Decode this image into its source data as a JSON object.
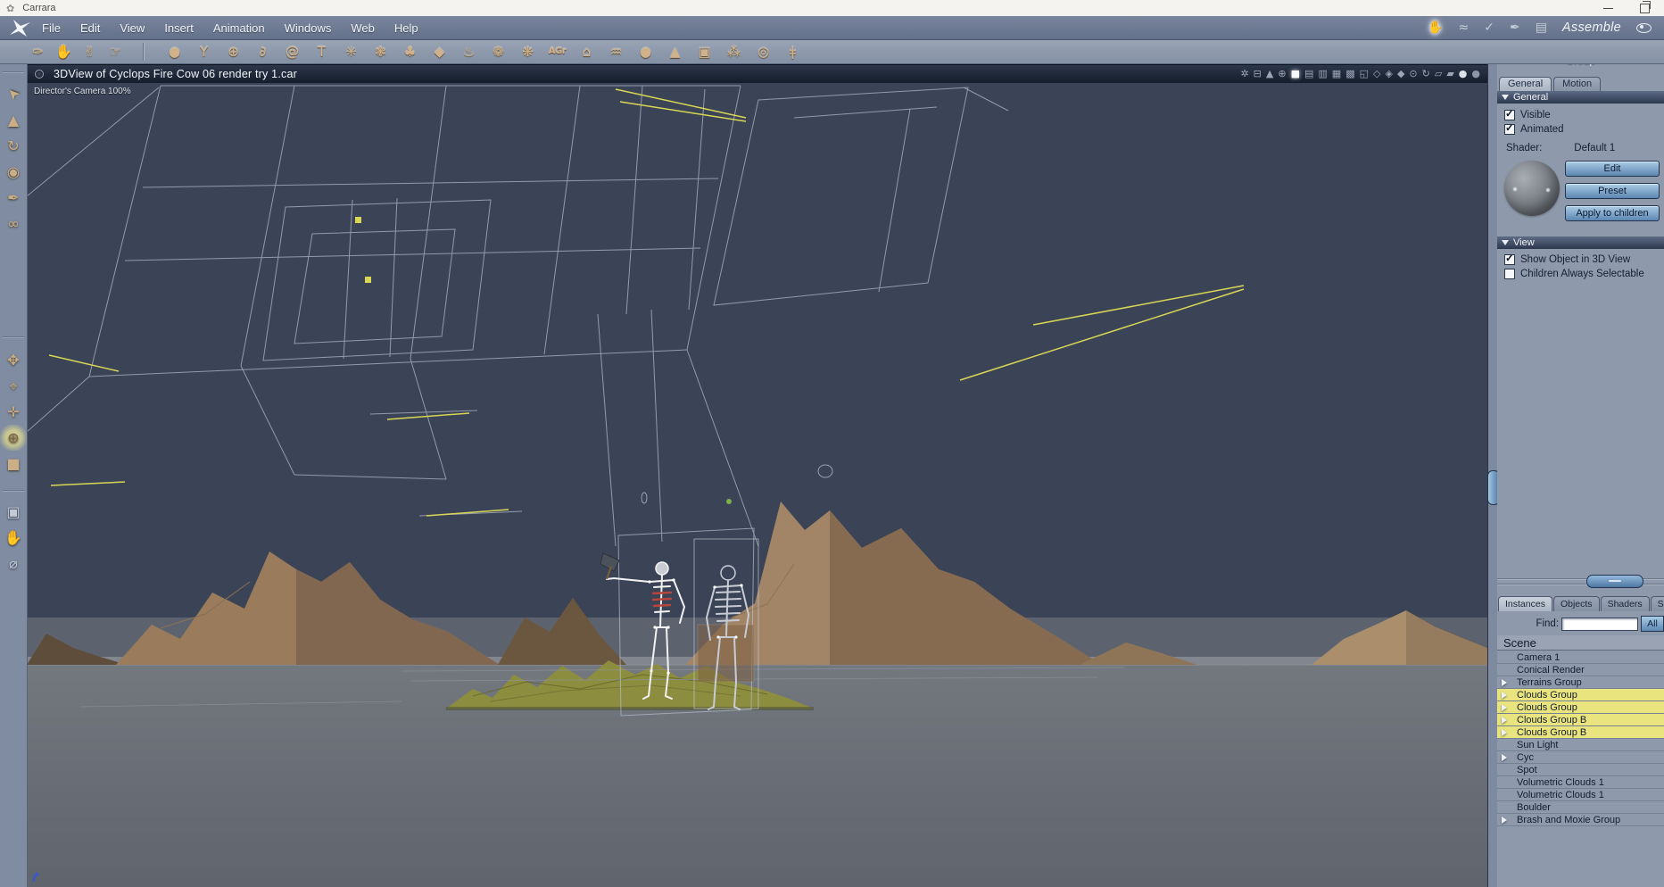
{
  "window": {
    "title": "Carrara"
  },
  "menu_bar": {
    "items": [
      {
        "name": "menu-file",
        "label": "File"
      },
      {
        "name": "menu-edit",
        "label": "Edit"
      },
      {
        "name": "menu-view",
        "label": "View"
      },
      {
        "name": "menu-insert",
        "label": "Insert"
      },
      {
        "name": "menu-animation",
        "label": "Animation"
      },
      {
        "name": "menu-windows",
        "label": "Windows"
      },
      {
        "name": "menu-web",
        "label": "Web"
      },
      {
        "name": "menu-help",
        "label": "Help"
      }
    ],
    "right_tools": [
      {
        "name": "pan-hand-icon",
        "glyph": "✋",
        "cls": "active-tool"
      },
      {
        "name": "spline-mode-icon",
        "glyph": "≈"
      },
      {
        "name": "vertex-mode-icon",
        "glyph": "✓"
      },
      {
        "name": "pen-mode-icon",
        "glyph": "✒"
      },
      {
        "name": "film-mode-icon",
        "glyph": "▤"
      }
    ],
    "mode_label": "Assemble"
  },
  "toolbar": {
    "left_tools": [
      {
        "name": "bone-wrench-tool-icon",
        "glyph": "✑"
      },
      {
        "name": "grab-tool-icon",
        "glyph": "✋"
      },
      {
        "name": "gesture-tool-icon",
        "glyph": "✌"
      },
      {
        "name": "point-tool-icon",
        "glyph": "☞"
      }
    ],
    "insert_tools": [
      {
        "name": "sphere-primitive-icon",
        "glyph": "●"
      },
      {
        "name": "vertex-object-icon",
        "glyph": "Y"
      },
      {
        "name": "wire-globe-icon",
        "glyph": "⊕"
      },
      {
        "name": "duck-primitive-icon",
        "glyph": "∂"
      },
      {
        "name": "spiral-object-icon",
        "glyph": "@"
      },
      {
        "name": "text-object-icon",
        "glyph": "T"
      },
      {
        "name": "particle-ball-icon",
        "glyph": "✳"
      },
      {
        "name": "metaball-icon",
        "glyph": "❃"
      },
      {
        "name": "tree-object-icon",
        "glyph": "♣"
      },
      {
        "name": "rock-object-icon",
        "glyph": "◆"
      },
      {
        "name": "fire-object-icon",
        "glyph": "♨"
      },
      {
        "name": "cloud-object-icon",
        "glyph": "❁"
      },
      {
        "name": "fountain-object-icon",
        "glyph": "❋"
      },
      {
        "name": "atmosphere-agr-icon",
        "glyph": "AGr",
        "cls": "txt"
      },
      {
        "name": "building-object-icon",
        "glyph": "⌂"
      },
      {
        "name": "terrain-object-icon",
        "glyph": "♒"
      },
      {
        "name": "blob-object-icon",
        "glyph": "●"
      },
      {
        "name": "spotlight-object-icon",
        "glyph": "▲"
      },
      {
        "name": "camera-object-icon",
        "glyph": "▣"
      },
      {
        "name": "group-hierarchy-icon",
        "glyph": "⁂"
      },
      {
        "name": "target-helper-icon",
        "glyph": "◎"
      },
      {
        "name": "bone-object-icon",
        "glyph": "ǂ"
      }
    ]
  },
  "left_rail": {
    "group1": [
      {
        "name": "select-arrow-tool-icon",
        "glyph": "➤",
        "cls": "rot-ul"
      },
      {
        "name": "pyramid-pointer-tool-icon",
        "glyph": "▲"
      },
      {
        "name": "rotate-tool-icon",
        "glyph": "↻"
      },
      {
        "name": "ring-disc-tool-icon",
        "glyph": "◉"
      },
      {
        "name": "pen-knife-tool-icon",
        "glyph": "✒"
      },
      {
        "name": "link-tool-icon",
        "glyph": "∞"
      }
    ],
    "group2": [
      {
        "name": "move-tool-icon",
        "glyph": "✥"
      },
      {
        "name": "move-plane-tool-icon",
        "glyph": "⌖"
      },
      {
        "name": "move-3d-tool-icon",
        "glyph": "✛"
      },
      {
        "name": "virtual-trackball-tool-icon",
        "glyph": "⊕",
        "cls": "active-rail"
      },
      {
        "name": "room-corner-tool-icon",
        "glyph": "■"
      }
    ],
    "group3": [
      {
        "name": "camera-tool-icon",
        "glyph": "▣",
        "cls": "gray"
      },
      {
        "name": "pan-view-tool-icon",
        "glyph": "✋",
        "cls": "gray"
      },
      {
        "name": "zoom-tool-icon",
        "glyph": "⌀",
        "cls": "gray"
      }
    ]
  },
  "viewport": {
    "title": "3DView of Cyclops Fire Cow 06 render try 1.car",
    "camera_label": "Director's Camera 100%",
    "header_icons": [
      {
        "name": "particles-toggle-icon",
        "glyph": "✲"
      },
      {
        "name": "hierarchy-toggle-icon",
        "glyph": "⊟"
      },
      {
        "name": "terrain-preview-icon",
        "glyph": "▲"
      },
      {
        "name": "camera-gimbal-icon",
        "glyph": "⊕"
      },
      {
        "name": "single-pane-layout-icon",
        "glyph": "■",
        "cls": "bright"
      },
      {
        "name": "split-horizontal-layout-icon",
        "glyph": "▤"
      },
      {
        "name": "split-1-2-layout-icon",
        "glyph": "▥"
      },
      {
        "name": "grid-4-layout-icon",
        "glyph": "▦"
      },
      {
        "name": "grid-4b-layout-icon",
        "glyph": "▩"
      },
      {
        "name": "split-l-layout-icon",
        "glyph": "◱"
      },
      {
        "name": "shield-grid-view-icon",
        "glyph": "◇"
      },
      {
        "name": "shield-figure-view-icon",
        "glyph": "◈"
      },
      {
        "name": "shield-scene-view-icon",
        "glyph": "◆"
      },
      {
        "name": "orbit-up-icon",
        "glyph": "⊙"
      },
      {
        "name": "rotate-view-icon",
        "glyph": "↻"
      },
      {
        "name": "wireframe-cube-icon",
        "glyph": "▱"
      },
      {
        "name": "solid-cube-icon",
        "glyph": "▰"
      },
      {
        "name": "shaded-sphere-light-icon",
        "glyph": "●",
        "cls": "ball-light"
      },
      {
        "name": "shaded-sphere-dark-icon",
        "glyph": "●",
        "cls": "ball-dark"
      }
    ]
  },
  "group_panel": {
    "title": "Group",
    "tabs": [
      {
        "name": "tab-general",
        "label": "General",
        "active": true
      },
      {
        "name": "tab-motion",
        "label": "Motion"
      }
    ],
    "general": {
      "header": "General",
      "options": [
        {
          "name": "visible-checkbox",
          "label": "Visible",
          "checked": true
        },
        {
          "name": "animated-checkbox",
          "label": "Animated",
          "checked": true
        }
      ],
      "shader_label": "Shader:",
      "shader_value": "Default 1",
      "buttons": [
        {
          "name": "edit-button",
          "label": "Edit"
        },
        {
          "name": "preset-button",
          "label": "Preset"
        },
        {
          "name": "apply-to-children-button",
          "label": "Apply to children"
        }
      ]
    },
    "view": {
      "header": "View",
      "options": [
        {
          "name": "show-object-checkbox",
          "label": "Show Object in 3D View",
          "checked": true
        },
        {
          "name": "children-selectable-checkbox",
          "label": "Children Always Selectable",
          "checked": false
        }
      ]
    }
  },
  "browser_panel": {
    "tabs": [
      {
        "name": "tab-instances",
        "label": "Instances",
        "active": true
      },
      {
        "name": "tab-objects",
        "label": "Objects"
      },
      {
        "name": "tab-shaders",
        "label": "Shaders"
      },
      {
        "name": "tab-sounds",
        "label": "Sounds"
      }
    ],
    "find_label": "Find:",
    "find_value": "",
    "all_button": "All",
    "scene_header": "Scene",
    "items": [
      {
        "label": "Camera 1"
      },
      {
        "label": "Conical Render"
      },
      {
        "label": "Terrains Group",
        "arrow": true
      },
      {
        "label": "Clouds Group",
        "arrow": true,
        "highlight": true
      },
      {
        "label": "Clouds Group",
        "arrow": true,
        "highlight": true
      },
      {
        "label": "Clouds Group B",
        "arrow": true,
        "highlight": true
      },
      {
        "label": "Clouds Group B",
        "arrow": true,
        "highlight": true
      },
      {
        "label": "Sun Light"
      },
      {
        "label": "Cyc",
        "arrow": true
      },
      {
        "label": "Spot"
      },
      {
        "label": "Volumetric Clouds 1"
      },
      {
        "label": "Volumetric Clouds 1"
      },
      {
        "label": "Boulder"
      },
      {
        "label": "Brash and Moxie Group",
        "arrow": true
      }
    ]
  },
  "colors": {
    "viewport_bg": "#3b4456",
    "panel_bg": "#8e99ab",
    "highlight_yellow": "#e9e47d",
    "accent_blue": "#6f9cc6",
    "wireframe": "#b3bcca",
    "guide_yellow": "#d9d654"
  }
}
